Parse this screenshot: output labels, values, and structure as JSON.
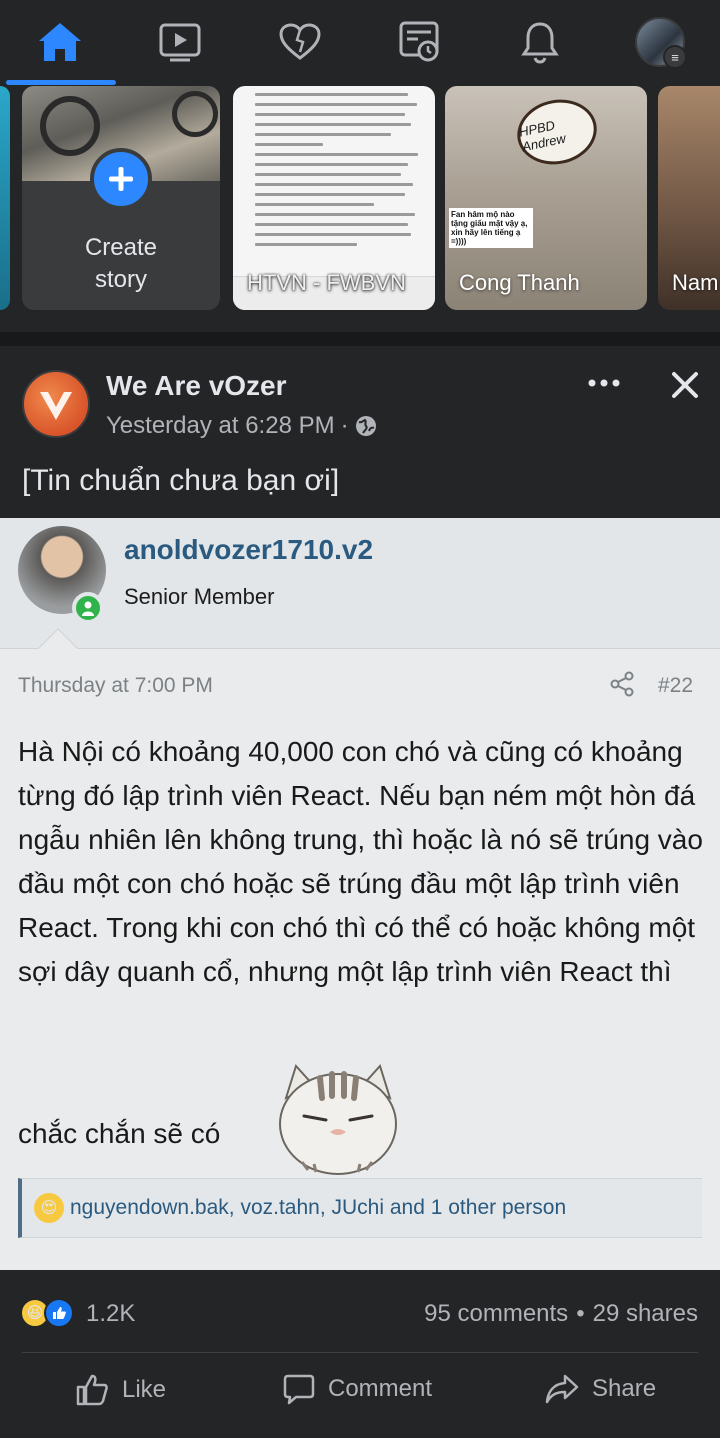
{
  "nav": {
    "items": [
      {
        "name": "home",
        "active": true
      },
      {
        "name": "watch"
      },
      {
        "name": "dating"
      },
      {
        "name": "news"
      },
      {
        "name": "notifications"
      },
      {
        "name": "profile-menu"
      }
    ],
    "accent": "#2d88ff"
  },
  "stories": {
    "create_label": "Create\nstory",
    "items": [
      {
        "name": "HTVN - FWBVN"
      },
      {
        "name": "Cong Thanh",
        "cake_text": "HPBD Andrew",
        "caption": "Fan hâm mộ nào tặng giấu mặt vậy ạ, xin hãy lên tiếng ạ =))))"
      },
      {
        "name": "Nam"
      }
    ]
  },
  "post": {
    "page_name": "We Are vOzer",
    "time": "Yesterday at 6:28 PM",
    "separator": "·",
    "caption": "[Tin chuẩn chưa bạn ơi]",
    "screenshot": {
      "username": "anoldvozer1710.v2",
      "role": "Senior Member",
      "date": "Thursday at 7:00 PM",
      "post_number": "#22",
      "body": "Hà Nội có khoảng 40,000 con chó và cũng có khoảng từng đó lập trình viên React. Nếu bạn ném một hòn đá ngẫu nhiên lên không trung, thì hoặc là nó sẽ trúng vào đầu một con chó hoặc sẽ trúng đầu một lập trình viên React. Trong khi con chó thì có thể có hoặc không một sợi dây quanh cổ, nhưng một lập trình viên React thì",
      "tail": "chắc chắn sẽ có",
      "reactions": "nguyendown.bak, voz.tahn, JUchi and 1 other person"
    },
    "stats": {
      "reactions_count": "1.2K",
      "comments": "95 comments",
      "dot": "•",
      "shares": "29 shares"
    },
    "actions": {
      "like": "Like",
      "comment": "Comment",
      "share": "Share"
    }
  }
}
